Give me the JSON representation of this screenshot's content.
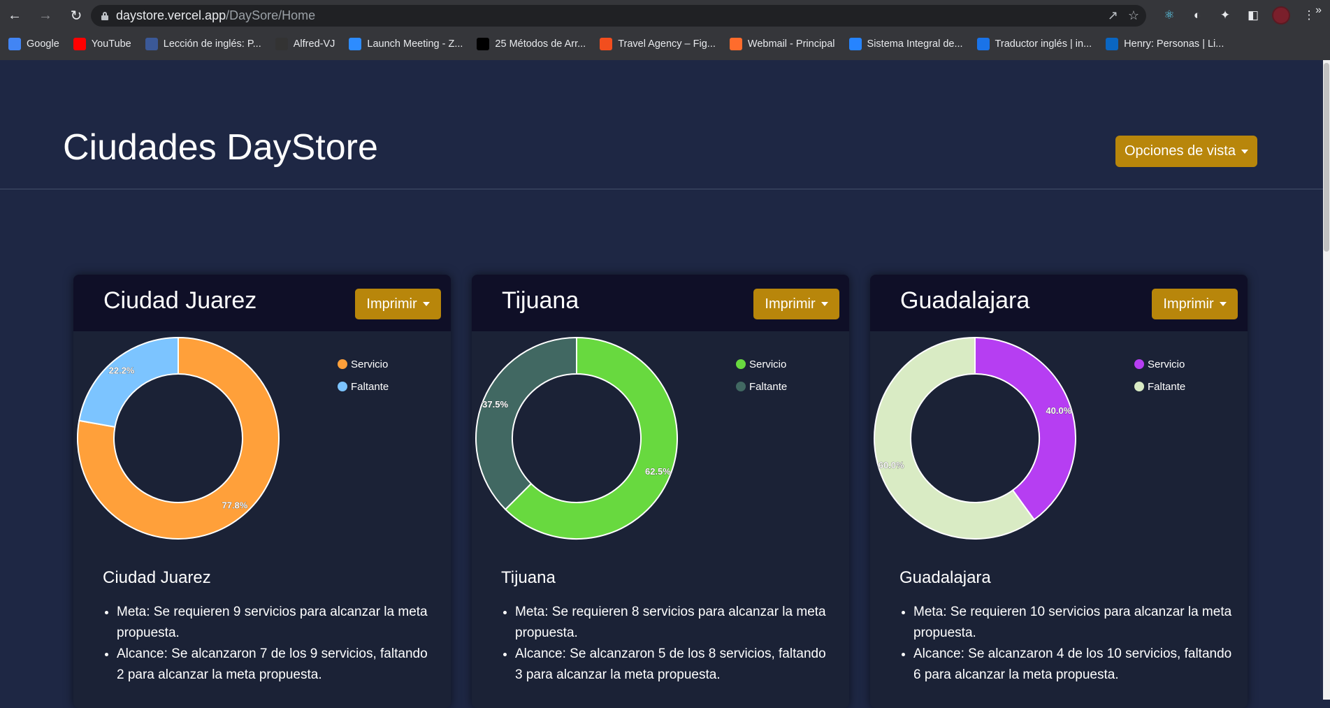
{
  "browser": {
    "url_host": "daystore.vercel.app",
    "url_path": "/DaySore/Home",
    "bookmarks": [
      {
        "label": "Google",
        "icon": "google-icon",
        "color": "#4285f4"
      },
      {
        "label": "YouTube",
        "icon": "youtube-icon",
        "color": "#ff0000"
      },
      {
        "label": "Lección de inglés: P...",
        "icon": "flag-icon",
        "color": "#3b5998"
      },
      {
        "label": "Alfred-VJ",
        "icon": "github-icon",
        "color": "#333333"
      },
      {
        "label": "Launch Meeting - Z...",
        "icon": "zoom-icon",
        "color": "#2d8cff"
      },
      {
        "label": "25 Métodos de Arr...",
        "icon": "dev-icon",
        "color": "#000000"
      },
      {
        "label": "Travel Agency – Fig...",
        "icon": "figma-icon",
        "color": "#f24e1e"
      },
      {
        "label": "Webmail - Principal",
        "icon": "cpanel-icon",
        "color": "#ff6c2c"
      },
      {
        "label": "Sistema Integral de...",
        "icon": "jira-icon",
        "color": "#2684ff"
      },
      {
        "label": "Traductor inglés | in...",
        "icon": "info-icon",
        "color": "#1a73e8"
      },
      {
        "label": "Henry: Personas | Li...",
        "icon": "linkedin-icon",
        "color": "#0a66c2"
      }
    ]
  },
  "header": {
    "title": "Ciudades DayStore",
    "view_options_label": "Opciones de vista"
  },
  "cards": [
    {
      "title": "Ciudad Juarez",
      "print_label": "Imprimir",
      "subtitle": "Ciudad Juarez",
      "goal_text": "Meta: Se requieren 9 servicios para alcanzar la meta propuesta.",
      "reach_text": "Alcance: Se alcanzaron 7 de los 9 servicios, faltando 2 para alcanzar la meta propuesta."
    },
    {
      "title": "Tijuana",
      "print_label": "Imprimir",
      "subtitle": "Tijuana",
      "goal_text": "Meta: Se requieren 8 servicios para alcanzar la meta propuesta.",
      "reach_text": "Alcance: Se alcanzaron 5 de los 8 servicios, faltando 3 para alcanzar la meta propuesta."
    },
    {
      "title": "Guadalajara",
      "print_label": "Imprimir",
      "subtitle": "Guadalajara",
      "goal_text": "Meta: Se requieren 10 servicios para alcanzar la meta propuesta.",
      "reach_text": "Alcance: Se alcanzaron 4 de los 10 servicios, faltando 6 para alcanzar la meta propuesta."
    }
  ],
  "chart_data": [
    {
      "type": "pie",
      "categories": [
        "Servicio",
        "Faltante"
      ],
      "values": [
        77.8,
        22.2
      ],
      "labels": [
        "77.8%",
        "22.2%"
      ],
      "colors": [
        "#ffa03a",
        "#7cc4ff"
      ],
      "legend": "top-right"
    },
    {
      "type": "pie",
      "categories": [
        "Servicio",
        "Faltante"
      ],
      "values": [
        62.5,
        37.5
      ],
      "labels": [
        "62.5%",
        "37.5%"
      ],
      "colors": [
        "#68d93f",
        "#416862"
      ],
      "legend": "top-right"
    },
    {
      "type": "pie",
      "categories": [
        "Servicio",
        "Faltante"
      ],
      "values": [
        40.0,
        60.0
      ],
      "labels": [
        "40.0%",
        "60.0%"
      ],
      "colors": [
        "#b63ef2",
        "#d9ebc4"
      ],
      "legend": "top-right"
    }
  ]
}
